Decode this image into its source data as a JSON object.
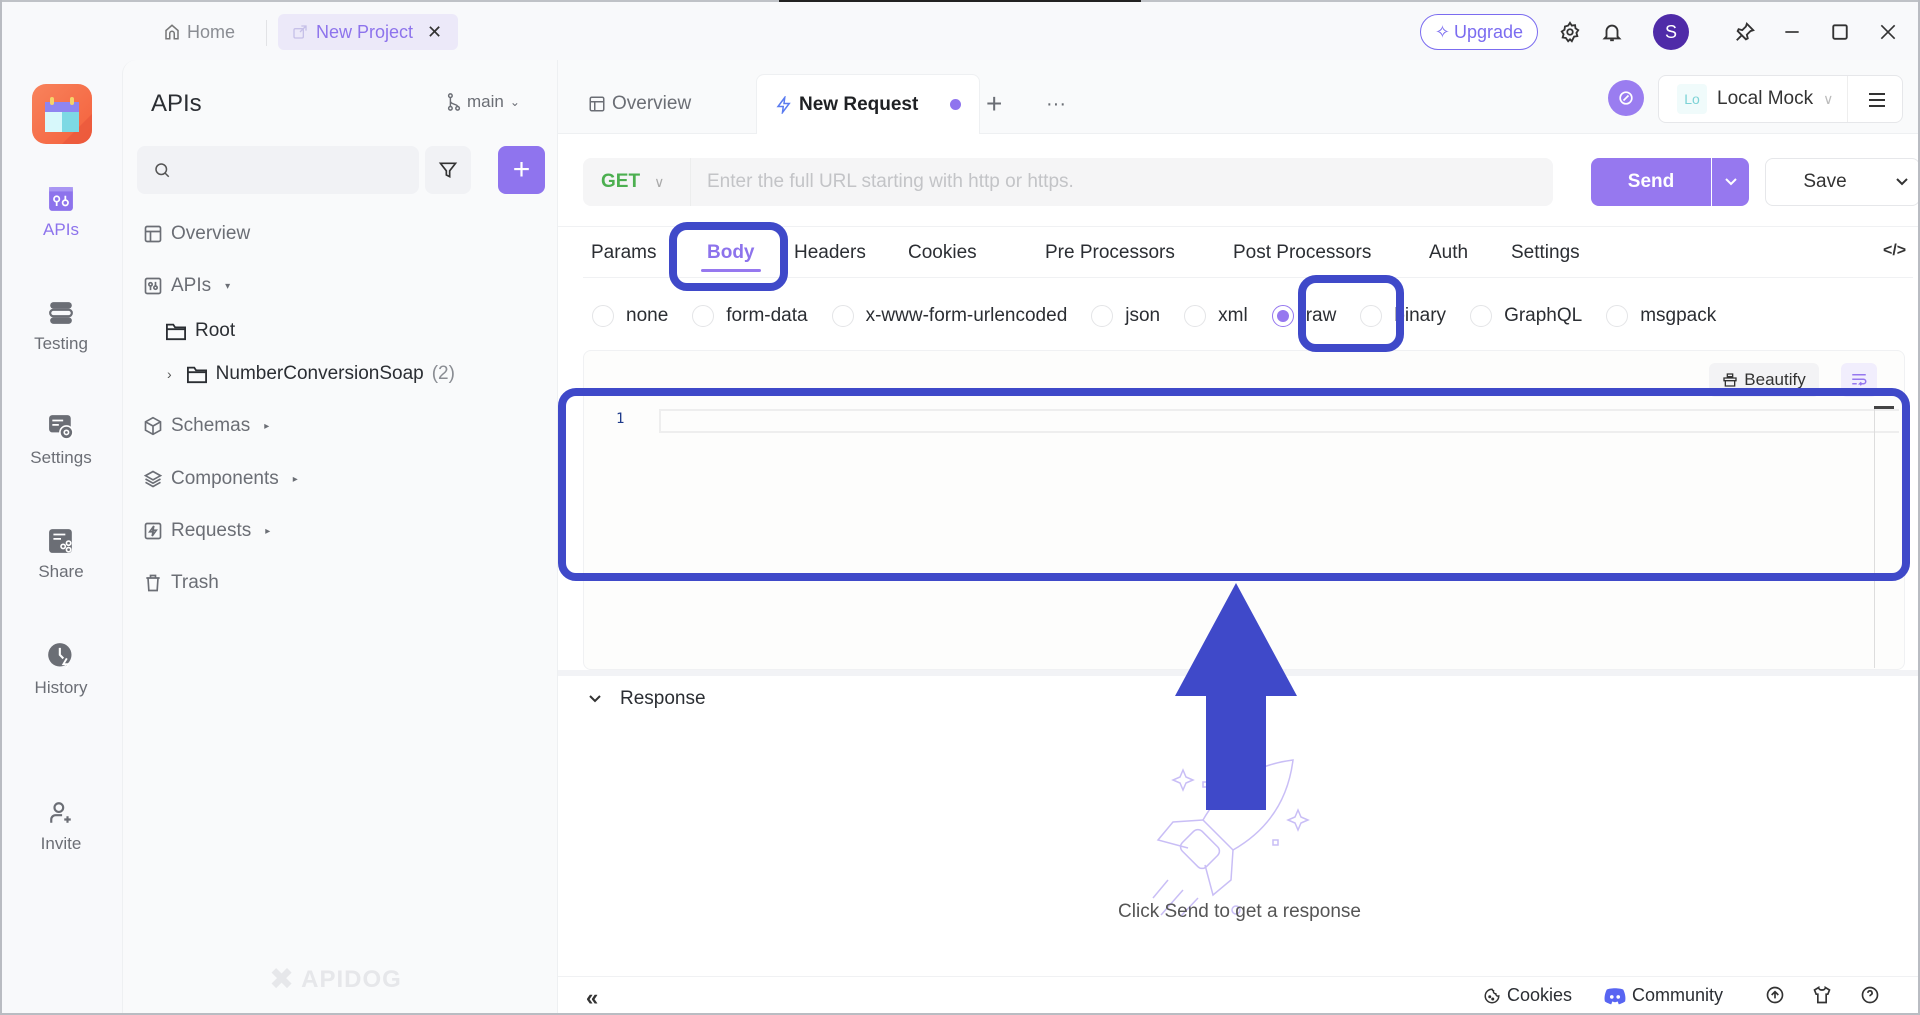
{
  "titlebar": {
    "home_label": "Home",
    "project_tab_label": "New Project",
    "upgrade_label": "Upgrade",
    "avatar_initial": "S"
  },
  "rail": {
    "items": [
      {
        "label": "APIs",
        "icon": "apis-icon",
        "active": true
      },
      {
        "label": "Testing",
        "icon": "testing-icon",
        "active": false
      },
      {
        "label": "Settings",
        "icon": "settings-icon",
        "active": false
      },
      {
        "label": "Share",
        "icon": "share-icon",
        "active": false
      },
      {
        "label": "History",
        "icon": "history-icon",
        "active": false
      },
      {
        "label": "Invite",
        "icon": "invite-icon",
        "active": false
      }
    ]
  },
  "sidebar": {
    "title": "APIs",
    "branch": "main",
    "search_placeholder": "",
    "tree": [
      {
        "label": "Overview",
        "icon": "overview-icon"
      },
      {
        "label": "APIs",
        "icon": "apis-icon",
        "caret": "▾"
      },
      {
        "label": "Root",
        "icon": "folder-icon"
      },
      {
        "label": "NumberConversionSoap",
        "icon": "folder-icon",
        "count": "(2)"
      },
      {
        "label": "Schemas",
        "icon": "schema-icon",
        "caret": "▸"
      },
      {
        "label": "Components",
        "icon": "components-icon",
        "caret": "▸"
      },
      {
        "label": "Requests",
        "icon": "requests-icon",
        "caret": "▸"
      },
      {
        "label": "Trash",
        "icon": "trash-icon"
      }
    ],
    "watermark": "APIDOG"
  },
  "main": {
    "tabs": [
      {
        "label": "Overview",
        "active": false
      },
      {
        "label": "New Request",
        "active": true,
        "unsaved": true
      }
    ],
    "environment": {
      "badge": "Lo",
      "name": "Local Mock"
    },
    "request": {
      "method": "GET",
      "url_value": "",
      "url_placeholder": "Enter the full URL starting with http or https.",
      "send_label": "Send",
      "save_label": "Save"
    },
    "request_tabs": [
      "Params",
      "Body",
      "Headers",
      "Cookies",
      "Pre Processors",
      "Post Processors",
      "Auth",
      "Settings"
    ],
    "active_request_tab": "Body",
    "body_types": [
      "none",
      "form-data",
      "x-www-form-urlencoded",
      "json",
      "xml",
      "raw",
      "binary",
      "GraphQL",
      "msgpack"
    ],
    "selected_body_type": "raw",
    "editor": {
      "beautify_label": "Beautify",
      "line_numbers": [
        "1"
      ],
      "content": ""
    },
    "response": {
      "title": "Response",
      "hint": "Click Send to get a response"
    },
    "footer": {
      "cookies_label": "Cookies",
      "community_label": "Community"
    }
  },
  "colors": {
    "accent": "#9678ef",
    "method_get": "#4caf50",
    "annotation": "#3f49c9",
    "logo": "#f4603c"
  }
}
